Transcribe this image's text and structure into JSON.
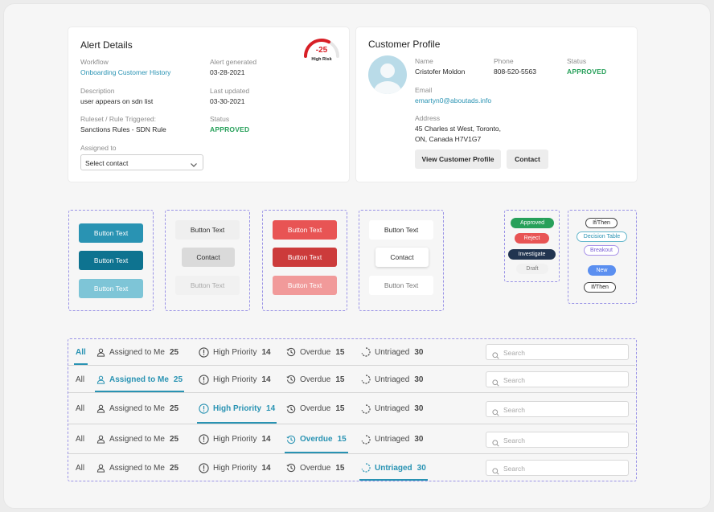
{
  "alert": {
    "title": "Alert Details",
    "workflow_label": "Workflow",
    "workflow_value": "Onboarding Customer History",
    "generated_label": "Alert generated",
    "generated_value": "03-28-2021",
    "description_label": "Description",
    "description_value": "user appears on sdn list",
    "updated_label": "Last updated",
    "updated_value": "03-30-2021",
    "ruleset_label": "Ruleset / Rule Triggered:",
    "ruleset_value": "Sanctions Rules - SDN Rule",
    "status_label": "Status",
    "status_value": "APPROVED",
    "assigned_label": "Assigned to",
    "assigned_select": "Select contact",
    "risk_score": "-25",
    "risk_label": "High Risk",
    "risk_level": 0.65
  },
  "profile": {
    "title": "Customer Profile",
    "name_label": "Name",
    "name_value": "Cristofer Moldon",
    "phone_label": "Phone",
    "phone_value": "808-520-5563",
    "status_label": "Status",
    "status_value": "APPROVED",
    "email_label": "Email",
    "email_value": "emartyn0@aboutads.info",
    "address_label": "Address",
    "address_line1": "45 Charles st West, Toronto,",
    "address_line2": "ON, Canada H7V1G7",
    "view_button": "View Customer Profile",
    "contact_button": "Contact"
  },
  "buttons": {
    "teal": [
      "Button Text",
      "Button Text",
      "Button Text"
    ],
    "gray": [
      "Button Text",
      "Contact",
      "Button Text"
    ],
    "red": [
      "Button Text",
      "Button Text",
      "Button Text"
    ],
    "white": [
      "Button Text",
      "Contact",
      "Button Text"
    ]
  },
  "status_pills": [
    "Approved",
    "Reject",
    "Investigate",
    "Draft"
  ],
  "logic_pills": [
    "If/Then",
    "Decision Table",
    "Breakout",
    "New",
    "If/Then"
  ],
  "tabs": {
    "all": "All",
    "assigned_label": "Assigned to Me",
    "assigned_count": "25",
    "priority_label": "High Priority",
    "priority_count": "14",
    "overdue_label": "Overdue",
    "overdue_count": "15",
    "untriaged_label": "Untriaged",
    "untriaged_count": "30",
    "search_placeholder": "Search"
  },
  "colors": {
    "teal": "#2993b3",
    "dark_teal": "#0e7390",
    "light_teal": "#7ec5d7",
    "red": "#e85454",
    "approved_green": "#27a05a",
    "navy": "#213450",
    "dashed_border": "#9a93e6"
  }
}
